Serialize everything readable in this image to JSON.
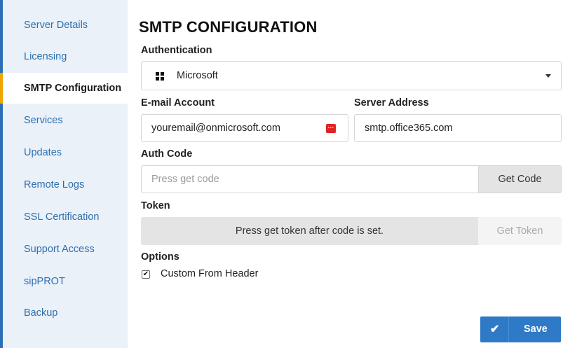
{
  "sidebar": {
    "items": [
      {
        "label": "Server Details",
        "active": false
      },
      {
        "label": "Licensing",
        "active": false
      },
      {
        "label": "SMTP Configuration",
        "active": true
      },
      {
        "label": "Services",
        "active": false
      },
      {
        "label": "Updates",
        "active": false
      },
      {
        "label": "Remote Logs",
        "active": false
      },
      {
        "label": "SSL Certification",
        "active": false
      },
      {
        "label": "Support Access",
        "active": false
      },
      {
        "label": "sipPROT",
        "active": false
      },
      {
        "label": "Backup",
        "active": false
      }
    ]
  },
  "main": {
    "title": "SMTP CONFIGURATION",
    "authentication": {
      "label": "Authentication",
      "selected": "Microsoft",
      "icon": "windows-icon"
    },
    "email_account": {
      "label": "E-mail Account",
      "value": "youremail@onmicrosoft.com",
      "icon": "password-manager-icon"
    },
    "server_address": {
      "label": "Server Address",
      "value": "smtp.office365.com"
    },
    "auth_code": {
      "label": "Auth Code",
      "placeholder": "Press get code",
      "value": "",
      "button": "Get Code"
    },
    "token": {
      "label": "Token",
      "value": "Press get token after code is set.",
      "button": "Get Token"
    },
    "options": {
      "label": "Options",
      "custom_from_header": {
        "label": "Custom From Header",
        "checked": true
      }
    },
    "save": {
      "label": "Save",
      "icon": "check-icon"
    }
  },
  "colors": {
    "sidebar_bg": "#eaf1f9",
    "sidebar_accent": "#2d6fb6",
    "active_marker": "#f0a500",
    "link_text": "#2f6fae",
    "primary_button": "#2f7ac6",
    "password_icon": "#e02424"
  }
}
